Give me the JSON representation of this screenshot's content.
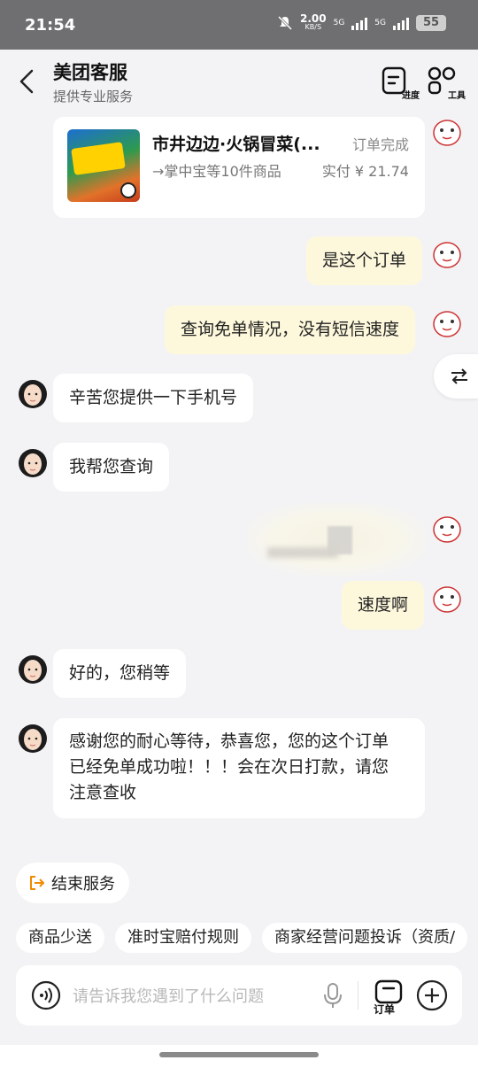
{
  "status_bar": {
    "time": "21:54",
    "net_speed": "2.00",
    "net_unit": "KB/S",
    "signal1": "5G",
    "signal2": "5G",
    "battery": "55"
  },
  "header": {
    "title": "美团客服",
    "subtitle": "提供专业服务",
    "progress_label": "进度",
    "tools_label": "工具"
  },
  "order_card": {
    "name": "市井边边·火锅冒菜(...",
    "status": "订单完成",
    "items": "→掌中宝等10件商品",
    "price": "实付 ¥ 21.74"
  },
  "messages": [
    {
      "from": "user",
      "text": "是这个订单"
    },
    {
      "from": "user",
      "text": "查询免单情况，没有短信速度"
    },
    {
      "from": "agent",
      "text": "辛苦您提供一下手机号"
    },
    {
      "from": "agent",
      "text": "我帮您查询"
    },
    {
      "from": "user",
      "text": "速度啊"
    },
    {
      "from": "agent",
      "text": "好的，您稍等"
    },
    {
      "from": "agent",
      "text_lines": [
        "感谢您的耐心等待，恭喜您，您的这个订单",
        "已经免单成功啦！！！会在次日打款，请您",
        "注意查收"
      ]
    }
  ],
  "end_service_label": "结束服务",
  "quick_chips": [
    "商品少送",
    "准时宝赔付规则",
    "商家经营问题投诉（资质/"
  ],
  "input": {
    "placeholder": "请告诉我您遇到了什么问题",
    "value": "",
    "order_label": "订单"
  },
  "colors": {
    "user_bubble": "#fdf8dc",
    "agent_bubble": "#ffffff",
    "accent": "#f08a00"
  }
}
